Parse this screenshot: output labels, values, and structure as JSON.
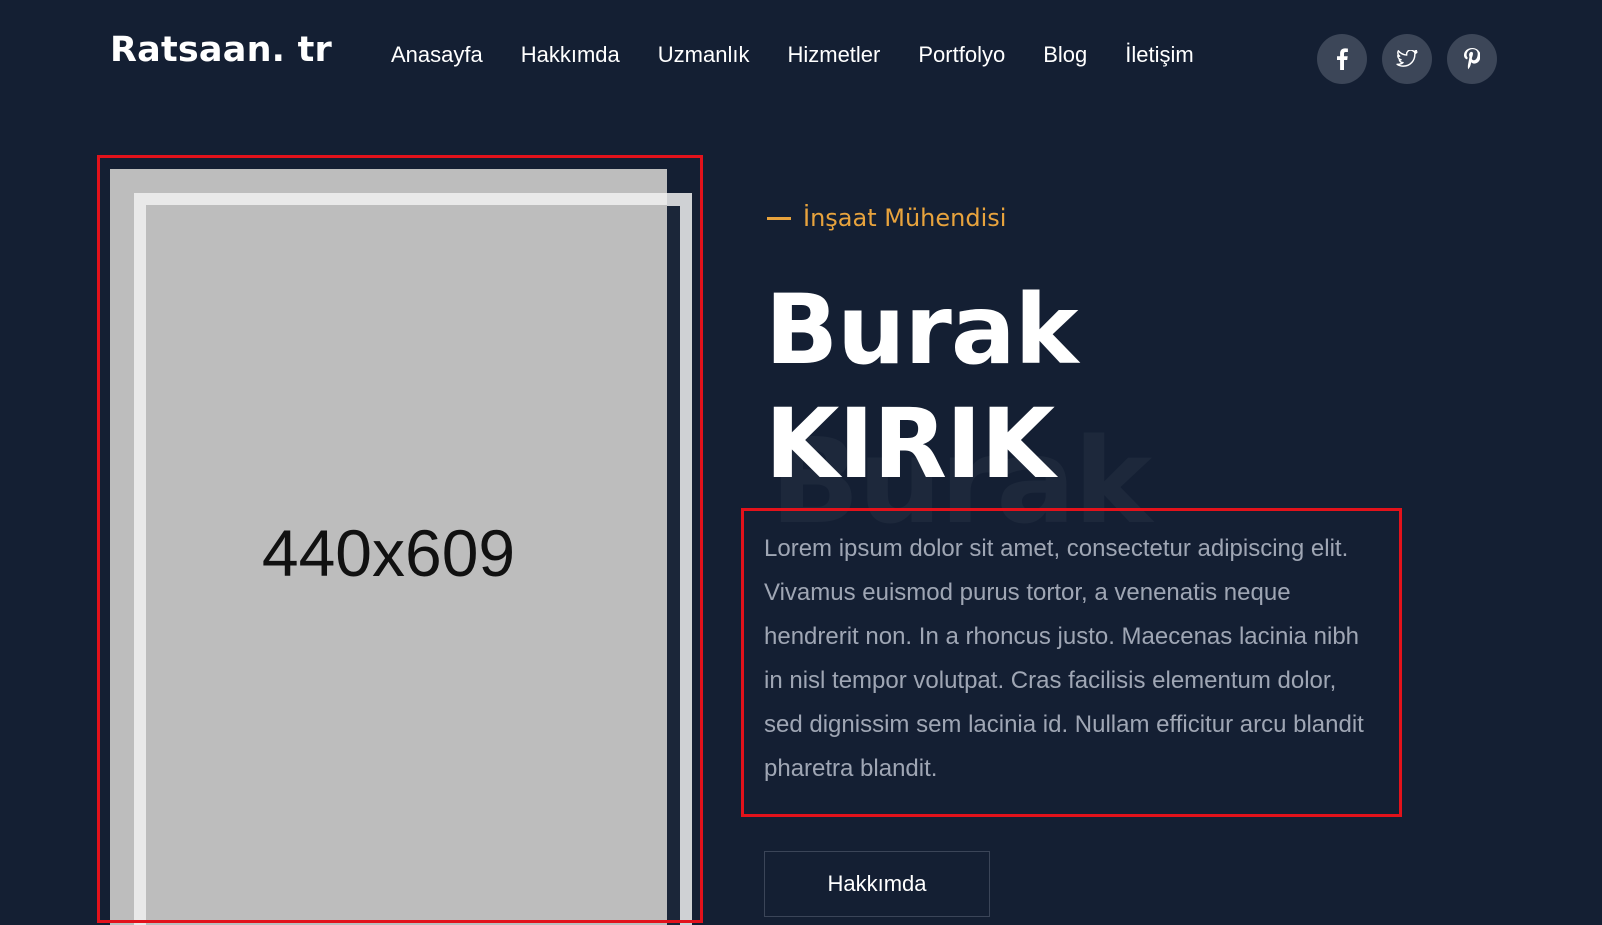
{
  "header": {
    "logo": "Ratsaan. tr",
    "nav": [
      "Anasayfa",
      "Hakkımda",
      "Uzmanlık",
      "Hizmetler",
      "Portfolyo",
      "Blog",
      "İletişim"
    ],
    "social": [
      {
        "icon": "facebook-icon"
      },
      {
        "icon": "twitter-icon"
      },
      {
        "icon": "pinterest-icon"
      }
    ]
  },
  "hero": {
    "image_placeholder": "440x609",
    "subtitle": "İnşaat Mühendisi",
    "name_first": "Burak",
    "name_last": "KIRIK",
    "watermark": "Burak",
    "description": "Lorem ipsum dolor sit amet, consectetur adipiscing elit. Vivamus euismod purus tortor, a venenatis neque hendrerit non. In a rhoncus justo. Maecenas lacinia nibh in nisl tempor volutpat. Cras facilisis elementum dolor, sed dignissim sem lacinia id. Nullam efficitur arcu blandit pharetra blandit.",
    "button": "Hakkımda"
  },
  "colors": {
    "background": "#141f33",
    "accent": "#e8a33d",
    "highlight_outline": "#e3121b"
  }
}
